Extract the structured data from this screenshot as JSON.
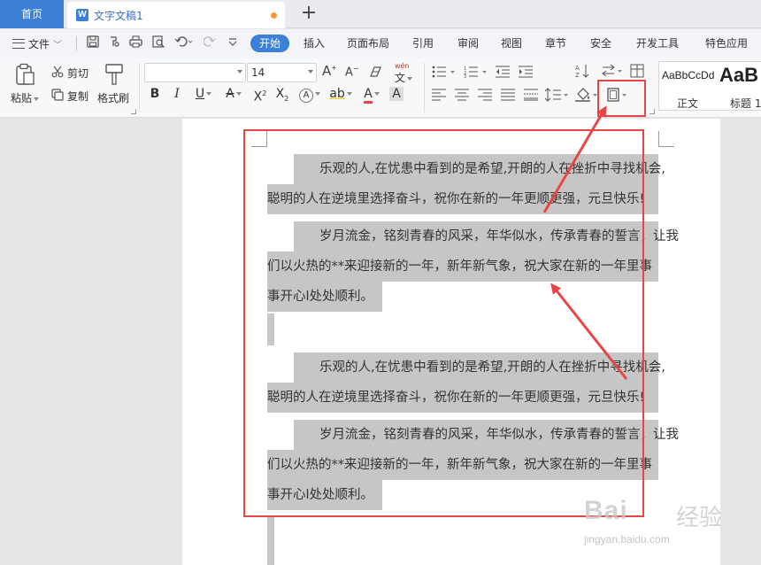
{
  "tabs": {
    "home": "首页",
    "doc_icon": "W",
    "doc_title": "文字文稿1",
    "new_tab": "+"
  },
  "menu": {
    "file": "文件",
    "tabs": [
      "开始",
      "插入",
      "页面布局",
      "引用",
      "审阅",
      "视图",
      "章节",
      "安全",
      "开发工具",
      "特色应用"
    ],
    "active_tab": "开始"
  },
  "ribbon": {
    "paste": "粘贴",
    "cut": "剪切",
    "copy": "复制",
    "format_painter": "格式刷",
    "font_name": "",
    "font_size": "14",
    "style_normal_sample": "AaBbCcDd",
    "style_normal_name": "正文",
    "style_heading_sample": "AaB",
    "style_heading_name": "标题 1"
  },
  "document": {
    "blocks": [
      {
        "lines": [
          "　　乐观的人,在忧患中看到的是希望,开朗的人在挫折中寻找机会,",
          "聪明的人在逆境里选择奋斗，祝你在新的一年更顺更强，元旦快乐!",
          "　　岁月流金，铭刻青春的风采，年华似水，传承青春的誓言，让我",
          "们以火热的**来迎接新的一年，新年新气象，祝大家在新的一年里事",
          "事开心l处处顺利。"
        ]
      },
      {
        "lines": [
          "　　乐观的人,在忧患中看到的是希望,开朗的人在挫折中寻找机会,",
          "聪明的人在逆境里选择奋斗，祝你在新的一年更顺更强，元旦快乐!",
          "　　岁月流金，铭刻青春的风采，年华似水，传承青春的誓言，让我",
          "们以火热的**来迎接新的一年，新年新气象，祝大家在新的一年里事",
          "事开心l处处顺利。"
        ]
      }
    ]
  },
  "watermark": {
    "brand": "Bai",
    "brand_cn": "经验",
    "url": "jingyan.baidu.com"
  },
  "colors": {
    "accent": "#3b7fd6",
    "annotation": "#e84545",
    "selection": "#c6c6c6"
  }
}
